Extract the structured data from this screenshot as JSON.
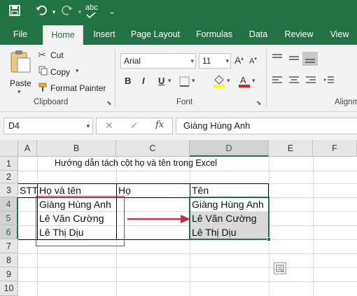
{
  "qat": {
    "save_icon": "save-icon",
    "undo_icon": "undo-icon",
    "redo_icon": "redo-icon",
    "spell_icon": "spelling-icon",
    "spell_label": "abc",
    "more_icon": "chevron-down-icon"
  },
  "tabs": [
    "File",
    "Home",
    "Insert",
    "Page Layout",
    "Formulas",
    "Data",
    "Review",
    "View"
  ],
  "ribbon": {
    "paste": "Paste",
    "cut": "Cut",
    "copy": "Copy",
    "format_painter": "Format Painter",
    "clipboard_label": "Clipboard",
    "font_name": "Arial",
    "font_size": "11",
    "font_label": "Font",
    "bold": "B",
    "italic": "I",
    "underline": "U",
    "alignment_label": "Alignm"
  },
  "formula_bar": {
    "name_box": "D4",
    "fx": "fx",
    "value": "Giàng Hùng Anh"
  },
  "columns": [
    "A",
    "B",
    "C",
    "D",
    "E",
    "F"
  ],
  "rows": [
    "1",
    "2",
    "3",
    "4",
    "5",
    "6",
    "7",
    "8",
    "9",
    "10"
  ],
  "sheet": {
    "title": "Hướng dẫn tách cột họ và tên trong Excel",
    "h_stt": "STT",
    "h_fullname": "Họ và tên",
    "h_last": "Họ",
    "h_first": "Tên",
    "names_b": [
      "Giàng Hùng Anh",
      "Lê Văn Cường",
      "Lê Thị Dịu"
    ],
    "names_d": [
      "Giàng Hùng Anh",
      "Lê Văn Cường",
      "Lê Thị Dịu"
    ]
  },
  "colors": {
    "excel_green": "#217346",
    "ribbon_bg": "#f3f3f3",
    "arrow_red": "#c0303a"
  }
}
